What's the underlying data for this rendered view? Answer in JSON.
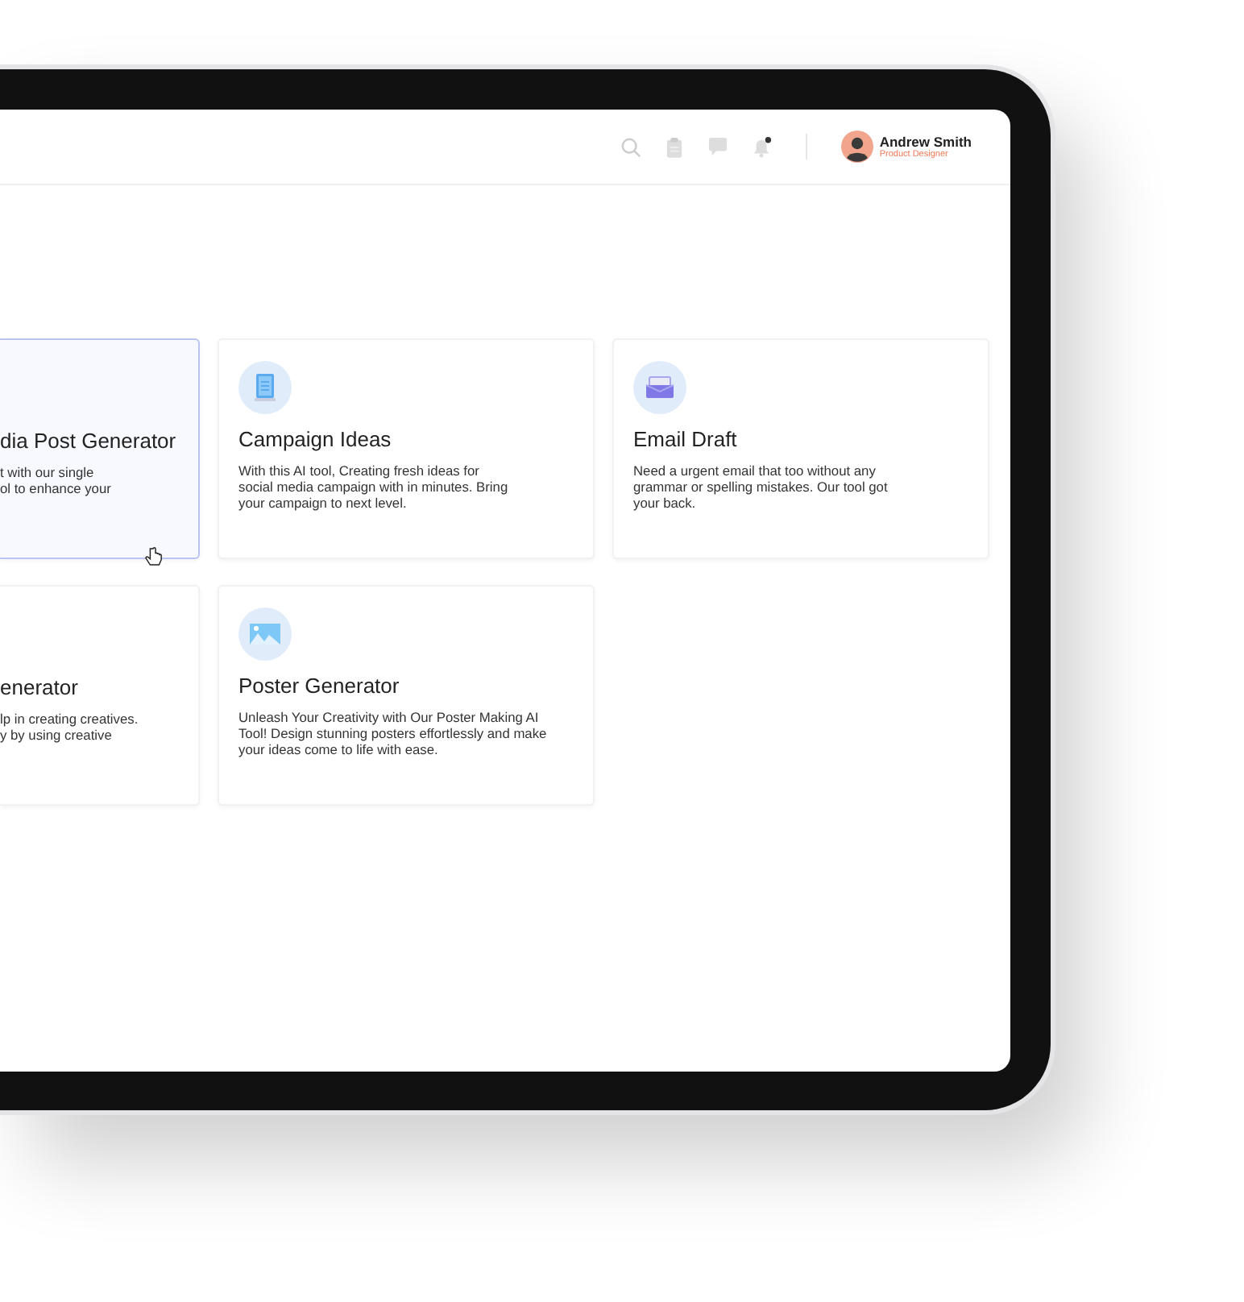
{
  "header": {
    "user": {
      "name": "Andrew Smith",
      "role": "Product Designer"
    },
    "notification_dot": true
  },
  "cards": [
    {
      "kind": "partial",
      "title": "dia Post Generator",
      "description": [
        "t with our single",
        "ol to enhance your"
      ],
      "selected": true
    },
    {
      "kind": "notebook",
      "title": "Campaign Ideas",
      "description": [
        "With this AI tool, Creating fresh ideas for",
        "social media campaign with in minutes. Bring",
        "your campaign  to next level."
      ],
      "selected": false
    },
    {
      "kind": "mail",
      "title": "Email Draft",
      "description": [
        "Need a urgent email that too without any",
        "grammar or spelling mistakes. Our tool got",
        "your back."
      ],
      "selected": false
    },
    {
      "kind": "partial",
      "title": "enerator",
      "description": [
        "lp in creating creatives.",
        "y by using creative"
      ],
      "selected": false
    },
    {
      "kind": "image",
      "title": "Poster Generator",
      "description": [
        "Unleash Your Creativity with Our Poster Making AI",
        "Tool! Design stunning posters effortlessly and make",
        "your ideas come to life with ease."
      ],
      "selected": false
    }
  ]
}
